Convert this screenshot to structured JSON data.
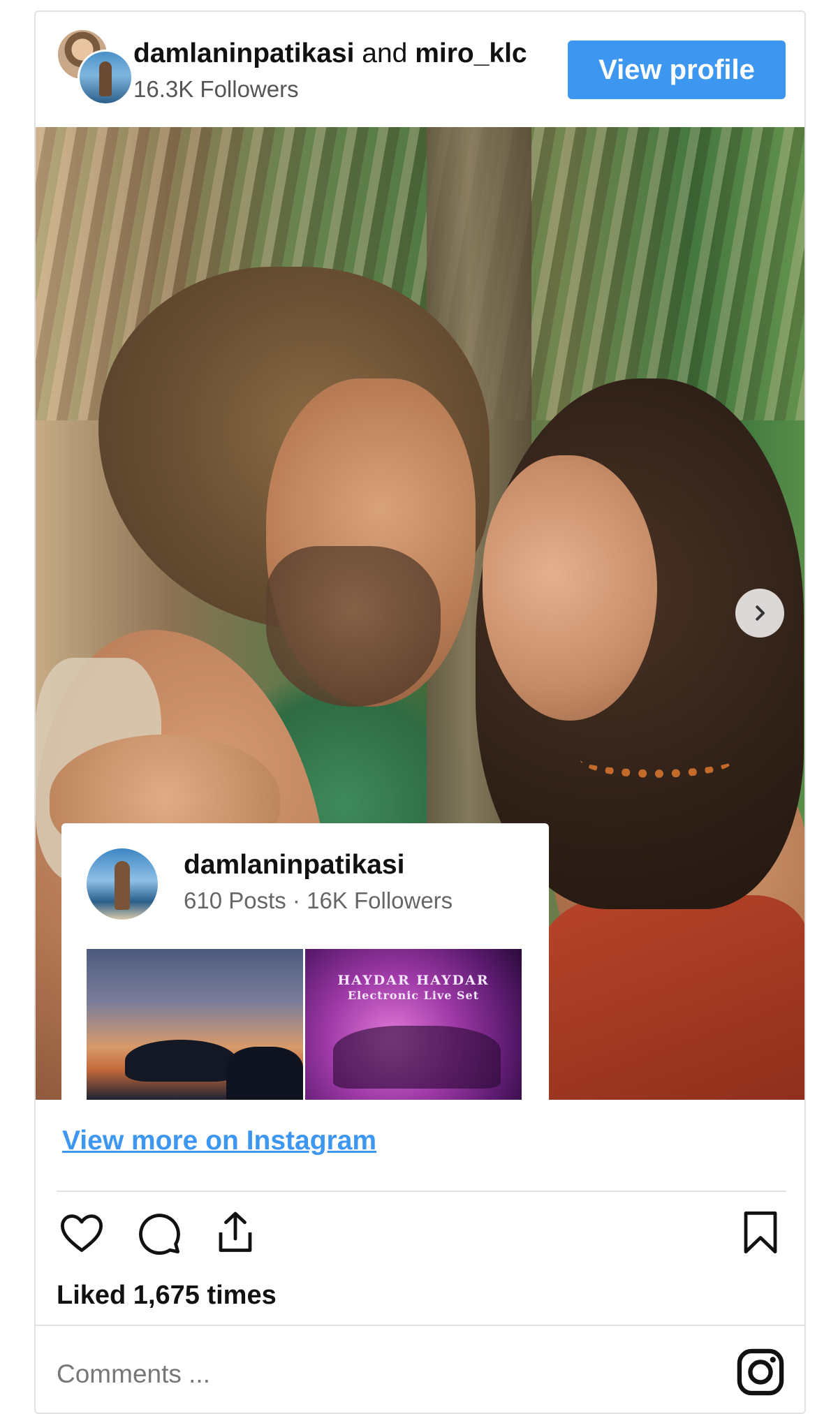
{
  "header": {
    "user1": "damlaninpatikasi",
    "joiner": "and",
    "user2": "miro_klc",
    "followers": "16.3K Followers",
    "view_profile_label": "View profile"
  },
  "overlay": {
    "name": "damlaninpatikasi",
    "stats": "610 Posts · 16K Followers",
    "thumb2_title": "HAYDAR HAYDAR",
    "thumb2_subtitle": "Electronic Live Set"
  },
  "actions": {
    "view_more": "View more on Instagram",
    "likes": "Liked 1,675 times",
    "comments_placeholder": "Comments ..."
  },
  "icons": [
    "heart-icon",
    "comment-icon",
    "share-icon",
    "bookmark-icon",
    "instagram-icon",
    "chevron-right-icon"
  ],
  "colors": {
    "accent": "#3d97f0",
    "divider": "#e1e1e1"
  }
}
